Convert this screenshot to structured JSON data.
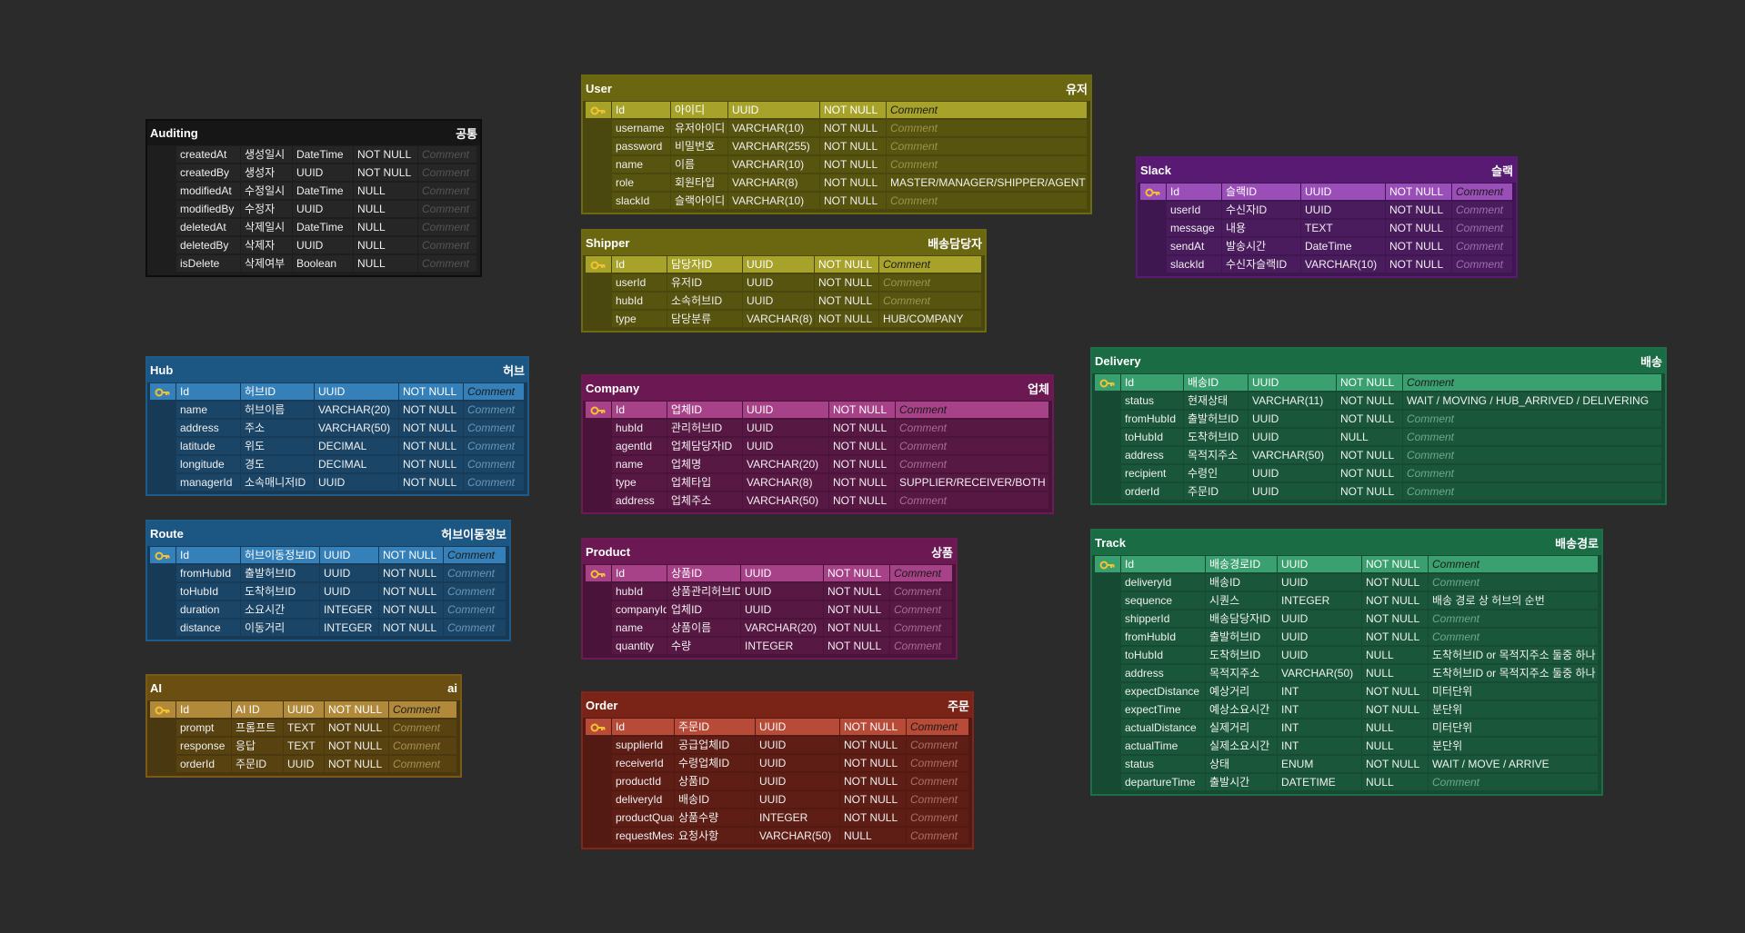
{
  "comment_placeholder": "Comment",
  "tables": [
    {
      "id": "auditing",
      "name": "Auditing",
      "korean": "공통",
      "colors": {
        "border": "#0d0d0d",
        "header": "#161616",
        "bg": "#1e1e1e",
        "pk": "#262626",
        "row": "#262626",
        "placeholder": "#555555"
      },
      "rows": [
        [
          "",
          "createdAt",
          "생성일시",
          "DateTime",
          "NOT NULL",
          ""
        ],
        [
          "",
          "createdBy",
          "생성자",
          "UUID",
          "NOT NULL",
          ""
        ],
        [
          "",
          "modifiedAt",
          "수정일시",
          "DateTime",
          "NULL",
          ""
        ],
        [
          "",
          "modifiedBy",
          "수정자",
          "UUID",
          "NULL",
          ""
        ],
        [
          "",
          "deletedAt",
          "삭제일시",
          "DateTime",
          "NULL",
          ""
        ],
        [
          "",
          "deletedBy",
          "삭제자",
          "UUID",
          "NULL",
          ""
        ],
        [
          "",
          "isDelete",
          "삭제여부",
          "Boolean",
          "NULL",
          ""
        ]
      ]
    },
    {
      "id": "user",
      "name": "User",
      "korean": "유저",
      "colors": {
        "border": "#6e6a10",
        "header": "#6b6711",
        "bg": "#4a470f",
        "pk": "#a7a22a",
        "row": "#57540f",
        "placeholder": "#9a9550"
      },
      "rows": [
        [
          "pk",
          "Id",
          "아이디",
          "UUID",
          "NOT NULL",
          ""
        ],
        [
          "",
          "username",
          "유저아이디",
          "VARCHAR(10)",
          "NOT NULL",
          ""
        ],
        [
          "",
          "password",
          "비밀번호",
          "VARCHAR(255)",
          "NOT NULL",
          ""
        ],
        [
          "",
          "name",
          "이름",
          "VARCHAR(10)",
          "NOT NULL",
          ""
        ],
        [
          "",
          "role",
          "회원타입",
          "VARCHAR(8)",
          "NOT NULL",
          "MASTER/MANAGER/SHIPPER/AGENT"
        ],
        [
          "",
          "slackId",
          "슬랙아이디",
          "VARCHAR(10)",
          "NOT NULL",
          ""
        ]
      ]
    },
    {
      "id": "shipper",
      "name": "Shipper",
      "korean": "배송담당자",
      "colors": {
        "border": "#6e6a10",
        "header": "#6b6711",
        "bg": "#4a470f",
        "pk": "#a7a22a",
        "row": "#57540f",
        "placeholder": "#9a9550"
      },
      "rows": [
        [
          "pk",
          "Id",
          "담당자ID",
          "UUID",
          "NOT NULL",
          ""
        ],
        [
          "",
          "userId",
          "유저ID",
          "UUID",
          "NOT NULL",
          ""
        ],
        [
          "",
          "hubId",
          "소속허브ID",
          "UUID",
          "NOT NULL",
          ""
        ],
        [
          "",
          "type",
          "담당분류",
          "VARCHAR(8)",
          "NOT NULL",
          "HUB/COMPANY"
        ]
      ]
    },
    {
      "id": "slack",
      "name": "Slack",
      "korean": "슬랙",
      "colors": {
        "border": "#5a1a75",
        "header": "#581a72",
        "bg": "#3e1750",
        "pk": "#9a4fb8",
        "row": "#4a1c5e",
        "placeholder": "#9a70ad"
      },
      "rows": [
        [
          "pk",
          "Id",
          "슬랙ID",
          "UUID",
          "NOT NULL",
          ""
        ],
        [
          "",
          "userId",
          "수신자ID",
          "UUID",
          "NOT NULL",
          ""
        ],
        [
          "",
          "message",
          "내용",
          "TEXT",
          "NOT NULL",
          ""
        ],
        [
          "",
          "sendAt",
          "발송시간",
          "DateTime",
          "NOT NULL",
          ""
        ],
        [
          "",
          "slackId",
          "수신자슬랙ID",
          "VARCHAR(10)",
          "NOT NULL",
          ""
        ]
      ]
    },
    {
      "id": "hub",
      "name": "Hub",
      "korean": "허브",
      "colors": {
        "border": "#1d5c8a",
        "header": "#1c5682",
        "bg": "#173b57",
        "pk": "#3580b8",
        "row": "#1b4566",
        "placeholder": "#6a95b5"
      },
      "rows": [
        [
          "pk",
          "Id",
          "허브ID",
          "UUID",
          "NOT NULL",
          ""
        ],
        [
          "",
          "name",
          "허브이름",
          "VARCHAR(20)",
          "NOT NULL",
          ""
        ],
        [
          "",
          "address",
          "주소",
          "VARCHAR(50)",
          "NOT NULL",
          ""
        ],
        [
          "",
          "latitude",
          "위도",
          "DECIMAL",
          "NOT NULL",
          ""
        ],
        [
          "",
          "longitude",
          "경도",
          "DECIMAL",
          "NOT NULL",
          ""
        ],
        [
          "",
          "managerId",
          "소속매니저ID",
          "UUID",
          "NOT NULL",
          ""
        ]
      ]
    },
    {
      "id": "company",
      "name": "Company",
      "korean": "업체",
      "colors": {
        "border": "#6e1a56",
        "header": "#6b1853",
        "bg": "#4a1339",
        "pk": "#a84288",
        "row": "#571844",
        "placeholder": "#a66e95"
      },
      "rows": [
        [
          "pk",
          "Id",
          "업체ID",
          "UUID",
          "NOT NULL",
          ""
        ],
        [
          "",
          "hubId",
          "관리허브ID",
          "UUID",
          "NOT NULL",
          ""
        ],
        [
          "",
          "agentId",
          "업체담당자ID",
          "UUID",
          "NOT NULL",
          ""
        ],
        [
          "",
          "name",
          "업체명",
          "VARCHAR(20)",
          "NOT NULL",
          ""
        ],
        [
          "",
          "type",
          "업체타입",
          "VARCHAR(8)",
          "NOT NULL",
          "SUPPLIER/RECEIVER/BOTH"
        ],
        [
          "",
          "address",
          "업체주소",
          "VARCHAR(50)",
          "NOT NULL",
          ""
        ]
      ]
    },
    {
      "id": "delivery",
      "name": "Delivery",
      "korean": "배송",
      "colors": {
        "border": "#1b7048",
        "header": "#1a6c45",
        "bg": "#164a32",
        "pk": "#3aa070",
        "row": "#1a573a",
        "placeholder": "#6da98a"
      },
      "rows": [
        [
          "pk",
          "Id",
          "배송ID",
          "UUID",
          "NOT NULL",
          ""
        ],
        [
          "",
          "status",
          "현재상태",
          "VARCHAR(11)",
          "NOT NULL",
          "WAIT / MOVING / HUB_ARRIVED / DELIVERING"
        ],
        [
          "",
          "fromHubId",
          "출발허브ID",
          "UUID",
          "NOT NULL",
          ""
        ],
        [
          "",
          "toHubId",
          "도착허브ID",
          "UUID",
          "NULL",
          ""
        ],
        [
          "",
          "address",
          "목적지주소",
          "VARCHAR(50)",
          "NOT NULL",
          ""
        ],
        [
          "",
          "recipient",
          "수령인",
          "UUID",
          "NOT NULL",
          ""
        ],
        [
          "",
          "orderId",
          "주문ID",
          "UUID",
          "NOT NULL",
          ""
        ]
      ]
    },
    {
      "id": "route",
      "name": "Route",
      "korean": "허브이동정보",
      "colors": {
        "border": "#1d5c8a",
        "header": "#1c5682",
        "bg": "#173b57",
        "pk": "#3580b8",
        "row": "#1b4566",
        "placeholder": "#6a95b5"
      },
      "rows": [
        [
          "pk",
          "Id",
          "허브이동정보ID",
          "UUID",
          "NOT NULL",
          ""
        ],
        [
          "",
          "fromHubId",
          "출발허브ID",
          "UUID",
          "NOT NULL",
          ""
        ],
        [
          "",
          "toHubId",
          "도착허브ID",
          "UUID",
          "NOT NULL",
          ""
        ],
        [
          "",
          "duration",
          "소요시간",
          "INTEGER",
          "NOT NULL",
          ""
        ],
        [
          "",
          "distance",
          "이동거리",
          "INTEGER",
          "NOT NULL",
          ""
        ]
      ]
    },
    {
      "id": "product",
      "name": "Product",
      "korean": "상품",
      "colors": {
        "border": "#6e1a56",
        "header": "#6b1853",
        "bg": "#4a1339",
        "pk": "#a84288",
        "row": "#571844",
        "placeholder": "#a66e95"
      },
      "rows": [
        [
          "pk",
          "Id",
          "상품ID",
          "UUID",
          "NOT NULL",
          ""
        ],
        [
          "",
          "hubId",
          "상품관리허브ID",
          "UUID",
          "NOT NULL",
          ""
        ],
        [
          "",
          "companyId",
          "업체ID",
          "UUID",
          "NOT NULL",
          ""
        ],
        [
          "",
          "name",
          "상품이름",
          "VARCHAR(20)",
          "NOT NULL",
          ""
        ],
        [
          "",
          "quantity",
          "수량",
          "INTEGER",
          "NOT NULL",
          ""
        ]
      ]
    },
    {
      "id": "track",
      "name": "Track",
      "korean": "배송경로",
      "colors": {
        "border": "#1b7048",
        "header": "#1a6c45",
        "bg": "#164a32",
        "pk": "#3aa070",
        "row": "#1a573a",
        "placeholder": "#6da98a"
      },
      "rows": [
        [
          "pk",
          "Id",
          "배송경로ID",
          "UUID",
          "NOT NULL",
          ""
        ],
        [
          "",
          "deliveryId",
          "배송ID",
          "UUID",
          "NOT NULL",
          ""
        ],
        [
          "",
          "sequence",
          "시퀀스",
          "INTEGER",
          "NOT NULL",
          "배송 경로 상 허브의 순번"
        ],
        [
          "",
          "shipperId",
          "배송담당자ID",
          "UUID",
          "NOT NULL",
          ""
        ],
        [
          "",
          "fromHubId",
          "출발허브ID",
          "UUID",
          "NOT NULL",
          ""
        ],
        [
          "",
          "toHubId",
          "도착허브ID",
          "UUID",
          "NULL",
          "도착허브ID or 목적지주소 둘중 하나"
        ],
        [
          "",
          "address",
          "목적지주소",
          "VARCHAR(50)",
          "NULL",
          "도착허브ID or 목적지주소 둘중 하나"
        ],
        [
          "",
          "expectDistance",
          "예상거리",
          "INT",
          "NOT NULL",
          "미터단위"
        ],
        [
          "",
          "expectTime",
          "예상소요시간",
          "INT",
          "NOT NULL",
          "분단위"
        ],
        [
          "",
          "actualDistance",
          "실제거리",
          "INT",
          "NULL",
          "미터단위"
        ],
        [
          "",
          "actualTime",
          "실제소요시간",
          "INT",
          "NULL",
          "분단위"
        ],
        [
          "",
          "status",
          "상태",
          "ENUM",
          "NOT NULL",
          "WAIT / MOVE / ARRIVE"
        ],
        [
          "",
          "departureTime",
          "출발시간",
          "DATETIME",
          "NULL",
          ""
        ]
      ]
    },
    {
      "id": "ai",
      "name": "AI",
      "korean": "ai",
      "colors": {
        "border": "#7a5a14",
        "header": "#6b4f12",
        "bg": "#4a3810",
        "pk": "#b08a3a",
        "row": "#574210",
        "placeholder": "#a88f55"
      },
      "rows": [
        [
          "pk",
          "Id",
          "AI ID",
          "UUID",
          "NOT NULL",
          ""
        ],
        [
          "",
          "prompt",
          "프롬프트",
          "TEXT",
          "NOT NULL",
          ""
        ],
        [
          "",
          "response",
          "응답",
          "TEXT",
          "NOT NULL",
          ""
        ],
        [
          "",
          "orderId",
          "주문ID",
          "UUID",
          "NOT NULL",
          ""
        ]
      ]
    },
    {
      "id": "order",
      "name": "Order",
      "korean": "주문",
      "colors": {
        "border": "#82251a",
        "header": "#7a2317",
        "bg": "#521a13",
        "pk": "#b84a38",
        "row": "#5e1e16",
        "placeholder": "#ad7066"
      },
      "rows": [
        [
          "pk",
          "Id",
          "주문ID",
          "UUID",
          "NOT NULL",
          ""
        ],
        [
          "",
          "supplierId",
          "공급업체ID",
          "UUID",
          "NOT NULL",
          ""
        ],
        [
          "",
          "receiverId",
          "수령업체ID",
          "UUID",
          "NOT NULL",
          ""
        ],
        [
          "",
          "productId",
          "상품ID",
          "UUID",
          "NOT NULL",
          ""
        ],
        [
          "",
          "deliveryId",
          "배송ID",
          "UUID",
          "NOT NULL",
          ""
        ],
        [
          "",
          "productQuantity",
          "상품수량",
          "INTEGER",
          "NOT NULL",
          ""
        ],
        [
          "",
          "requestMessage",
          "요청사항",
          "VARCHAR(50)",
          "NULL",
          ""
        ]
      ]
    }
  ]
}
